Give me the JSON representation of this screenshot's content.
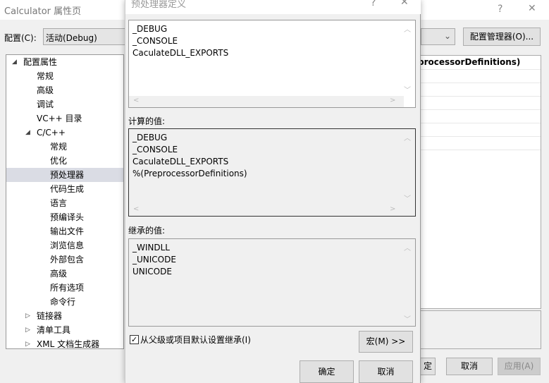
{
  "window": {
    "title": "Calculator 属性页",
    "help": "?",
    "close": "✕"
  },
  "config": {
    "label": "配置(C):",
    "value": "活动(Debug)",
    "manager_button": "配置管理器(O)..."
  },
  "tree": [
    {
      "label": "配置属性",
      "level": 0,
      "expanded": true
    },
    {
      "label": "常规",
      "level": 1
    },
    {
      "label": "高级",
      "level": 1
    },
    {
      "label": "调试",
      "level": 1
    },
    {
      "label": "VC++ 目录",
      "level": 1
    },
    {
      "label": "C/C++",
      "level": 1,
      "expanded": true
    },
    {
      "label": "常规",
      "level": 2
    },
    {
      "label": "优化",
      "level": 2
    },
    {
      "label": "预处理器",
      "level": 2,
      "selected": true
    },
    {
      "label": "代码生成",
      "level": 2
    },
    {
      "label": "语言",
      "level": 2
    },
    {
      "label": "预编译头",
      "level": 2
    },
    {
      "label": "输出文件",
      "level": 2
    },
    {
      "label": "浏览信息",
      "level": 2
    },
    {
      "label": "外部包含",
      "level": 2
    },
    {
      "label": "高级",
      "level": 2
    },
    {
      "label": "所有选项",
      "level": 2
    },
    {
      "label": "命令行",
      "level": 2
    },
    {
      "label": "链接器",
      "level": 1,
      "expanded": false
    },
    {
      "label": "清单工具",
      "level": 1,
      "expanded": false
    },
    {
      "label": "XML 文档生成器",
      "level": 1,
      "expanded": false
    }
  ],
  "grid": {
    "header_fragment": "processorDefinitions)"
  },
  "bottom": {
    "ok_fragment": "定",
    "cancel": "取消",
    "apply": "应用(A)"
  },
  "dialog": {
    "title": "预处理器定义",
    "help": "?",
    "close": "✕",
    "edit_lines": [
      "_DEBUG",
      "_CONSOLE",
      "CaculateDLL_EXPORTS"
    ],
    "computed_label": "计算的值:",
    "computed_lines": [
      "_DEBUG",
      "_CONSOLE",
      "CaculateDLL_EXPORTS",
      "%(PreprocessorDefinitions)"
    ],
    "inherited_label": "继承的值:",
    "inherited_lines": [
      "_WINDLL",
      "_UNICODE",
      "UNICODE"
    ],
    "inherit_checkbox": {
      "label": "从父级或项目默认设置继承(I)",
      "checked": true
    },
    "macro_button": "宏(M) >>",
    "ok": "确定",
    "cancel": "取消"
  }
}
